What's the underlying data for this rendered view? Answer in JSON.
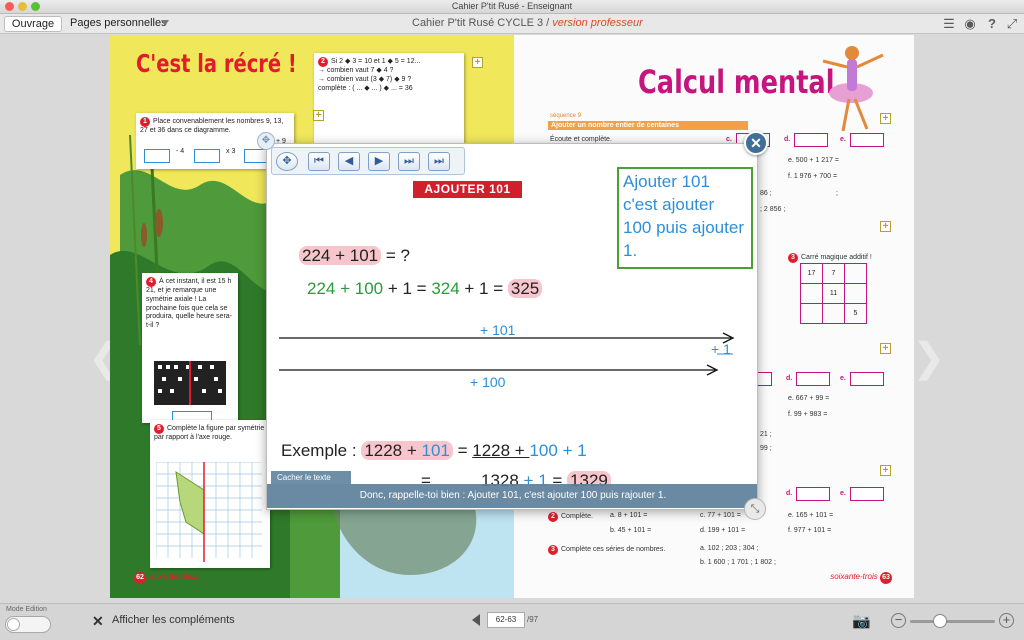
{
  "window": {
    "title": "Cahier P'tit Rusé - Enseignant"
  },
  "toolbar": {
    "tab_ouvrage": "Ouvrage",
    "tab_pages": "Pages personnelles",
    "book_title": "Cahier P'tit Rusé CYCLE 3 / ",
    "book_version": "version professeur",
    "icons": [
      "list-icon",
      "eye-icon",
      "help-icon",
      "fullscreen-icon"
    ]
  },
  "left_page": {
    "title": "C'est la récré !",
    "ex1_num": "1",
    "ex1_text": "Place convenablement les nombres 9, 13, 27 et 36 dans ce diagramme.",
    "ex1_ops": [
      "- 4",
      "x 3",
      "+ 9"
    ],
    "ex2_num": "2",
    "ex2_lines": [
      "Si 2 ◆ 3 = 10 et 1 ◆ 5 = 12...",
      "→ combien vaut 7 ◆ 4 ?",
      "→ combien vaut (3 ◆ 7) ◆ 9 ?",
      "complète : ( ... ◆ ... ) ◆ ... = 36"
    ],
    "ex4_num": "4",
    "ex4_text": "À cet instant, il est 15 h 21, et je remarque une symétrie axiale ! La prochaine fois que cela se produira, quelle heure sera-t-il ?",
    "ex5_num": "5",
    "ex5_text": "Complète la figure par symétrie par rapport à l'axe rouge.",
    "page_number": "62",
    "page_words": "soixante-deux"
  },
  "right_page": {
    "title": "Calcul mental",
    "sequence": "séquence 9",
    "banner": "Ajouter un nombre entier de centaines",
    "ex1": "Écoute et complète.",
    "ops_top": [
      "e. 500 + 1 217 =",
      "f. 1 976 + 700 ="
    ],
    "seq_frag": [
      ";",
      "86 ;",
      "; 2 856 ;"
    ],
    "ex3": "Carré magique additif !",
    "magic": [
      [
        "17",
        "7",
        ""
      ],
      [
        "",
        "11",
        ""
      ],
      [
        "",
        "",
        "5"
      ]
    ],
    "ops_mid": [
      "e. 667 + 99 =",
      "f. 99 + 983 ="
    ],
    "frag_mid": [
      "21 ;",
      "99 ;"
    ],
    "ex2_label": "Complète.",
    "ops_bottom": [
      [
        "a. 8 + 101 =",
        "c. 77 + 101 =",
        "e. 165 + 101 ="
      ],
      [
        "b. 45 + 101 =",
        "d. 199 + 101 =",
        "f. 977 + 101 ="
      ]
    ],
    "ex3b_label": "Complète ces séries de nombres.",
    "series": [
      "a. 102 ; 203 ; 304 ;",
      "b. 1 600 ; 1 701 ; 1 802 ;"
    ],
    "page_number": "63",
    "page_words": "soixante-trois",
    "letters": [
      "c.",
      "d.",
      "e."
    ]
  },
  "popup": {
    "banner": "AJOUTER 101",
    "note": "Ajouter 101 c'est ajouter 100 puis ajouter 1.",
    "line1_hl": "224 + 101",
    "line1_rest": " = ?",
    "line2_a": "224 + 100",
    "line2_b": " + 1 = ",
    "line2_c": "324",
    "line2_d": " + 1 = ",
    "line2_e": "325",
    "arrow_top": "+ 101",
    "arrow_plus1": "+ 1",
    "arrow_bottom": "+ 100",
    "ex_label": "Exemple : ",
    "ex_a": "1228 + ",
    "ex_b": "101",
    "ex_eq": " = ",
    "ex_c": "1228 + ",
    "ex_d": "100",
    "ex_e": " + 1",
    "ex2_eq": "=",
    "ex2_a": "1328 ",
    "ex2_b": "+ 1",
    "ex2_c": " = ",
    "ex2_d": "1329",
    "caption_tab": "Cacher le texte",
    "caption": "Donc, rappelle-toi bien : Ajouter 101, c'est ajouter 100 puis rajouter 1."
  },
  "bottom": {
    "mode_label": "Mode Edition",
    "show_complements": "Afficher les compléments",
    "page_input": "62-63",
    "page_total": "/97",
    "zoom_level": 0.35
  }
}
